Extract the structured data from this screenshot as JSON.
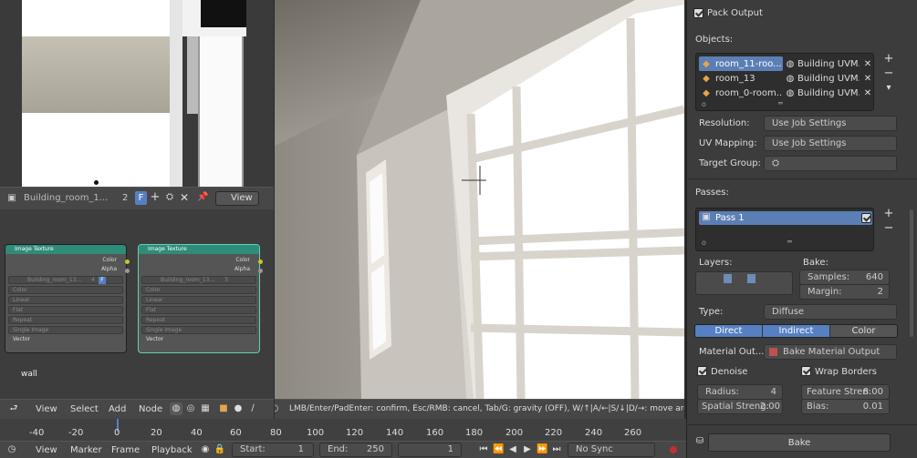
{
  "image_editor": {
    "image_name": "Building_room_1...",
    "users": "2",
    "fake_user": "F",
    "view_menu": "View"
  },
  "node_editor": {
    "nodes": [
      {
        "title": "Image Texture",
        "outputs": [
          "Color",
          "Alpha"
        ],
        "image": "Building_room_13...",
        "users": "4",
        "rows": [
          "Color",
          "Linear",
          "Flat",
          "Repeat",
          "Single Image"
        ],
        "input": "Vector"
      },
      {
        "title": "Image Texture",
        "outputs": [
          "Color",
          "Alpha"
        ],
        "image": "Building_room_13...",
        "users": "3",
        "rows": [
          "Color",
          "Linear",
          "Flat",
          "Repeat",
          "Single Image"
        ],
        "input": "Vector"
      }
    ],
    "material_label": "wall",
    "menu": [
      "View",
      "Select",
      "Add",
      "Node"
    ]
  },
  "viewport": {
    "status": "LMB/Enter/PadEnter: confirm, Esc/RMB: cancel, Tab/G: gravity (OFF), W/↑|A/←|S/↓|D/→: move around, Shift,L: fas"
  },
  "timeline": {
    "ruler": [
      "-40",
      "-20",
      "0",
      "20",
      "40",
      "60",
      "80",
      "100",
      "120",
      "140",
      "160",
      "180",
      "200",
      "220",
      "240",
      "260"
    ],
    "menu": [
      "View",
      "Marker",
      "Frame",
      "Playback"
    ],
    "start_label": "Start:",
    "start": "1",
    "end_label": "End:",
    "end": "250",
    "current": "1",
    "sync": "No Sync"
  },
  "bake": {
    "pack_output": "Pack Output",
    "objects_label": "Objects:",
    "objects": [
      {
        "name": "room_11-roo...",
        "material": "Building UVM..."
      },
      {
        "name": "room_13",
        "material": "Building UVM..."
      },
      {
        "name": "room_0-room...",
        "material": "Building UVM..."
      }
    ],
    "resolution_label": "Resolution:",
    "resolution": "Use Job Settings",
    "uv_mapping_label": "UV Mapping:",
    "uv_mapping": "Use Job Settings",
    "target_group_label": "Target Group:",
    "passes_label": "Passes:",
    "pass_name": "Pass 1",
    "layers_label": "Layers:",
    "bake_label": "Bake:",
    "samples_label": "Samples:",
    "samples": "640",
    "margin_label": "Margin:",
    "margin": "2",
    "type_label": "Type:",
    "type": "Diffuse",
    "light_tabs": [
      "Direct",
      "Indirect",
      "Color"
    ],
    "material_out_label": "Material Out...",
    "material_out": "Bake Material Output",
    "denoise": "Denoise",
    "wrap_borders": "Wrap Borders",
    "radius_label": "Radius:",
    "radius": "4",
    "spatial_label": "Spatial Streng:",
    "spatial": "2.00",
    "feature_label": "Feature Stren:",
    "feature": "8.00",
    "bias_label": "Bias:",
    "bias": "0.01",
    "bake_button": "Bake"
  },
  "colors": {
    "accent": "#5680c2",
    "node_header": "#2f8c78",
    "selected_blue": "#5b7fb5"
  }
}
